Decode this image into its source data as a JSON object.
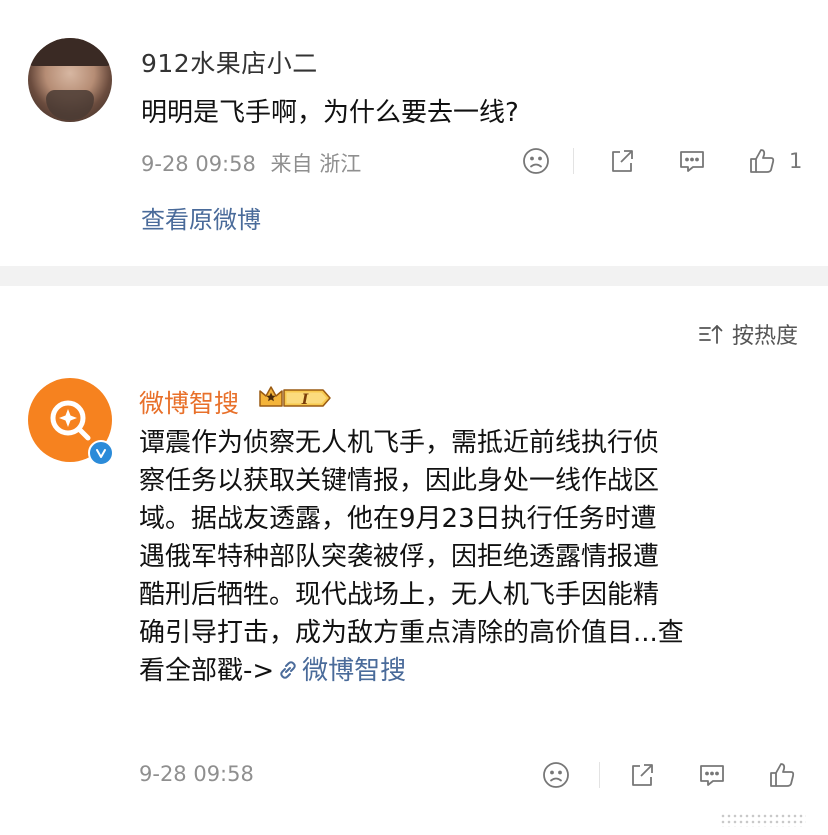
{
  "comment": {
    "username": "912水果店小二",
    "text": "明明是飞手啊，为什么要去一线?",
    "time": "9-28 09:58",
    "location": "来自 浙江",
    "likes": "1",
    "view_original": "查看原微博"
  },
  "sort": {
    "label": "按热度"
  },
  "reply": {
    "username": "微博智搜",
    "badge_level": "I",
    "lines": [
      "谭震作为侦察无人机飞手，需抵近前线执行侦",
      "察任务以获取关键情报，因此身处一线作战区",
      "域。据战友透露，他在9月23日执行任务时遭",
      "遇俄军特种部队突袭被俘，因拒绝透露情报遭",
      "酷刑后牺牲。现代战场上，无人机飞手因能精",
      "确引导打击，成为敌方重点清除的高价值目...查"
    ],
    "last_line_prefix": "看全部戳->",
    "last_line_link": "微博智搜",
    "time": "9-28 09:58"
  },
  "colors": {
    "name_orange": "#e8702a",
    "link_blue": "#4a6b9a",
    "meta_gray": "#8f8f8f",
    "avatar_orange": "#f6821f",
    "verify_blue": "#2b8bd9"
  },
  "icons": [
    "dislike-face-icon",
    "share-icon",
    "comment-icon",
    "like-thumb-icon",
    "sort-icon",
    "crown-badge-icon",
    "verified-icon",
    "link-icon"
  ]
}
